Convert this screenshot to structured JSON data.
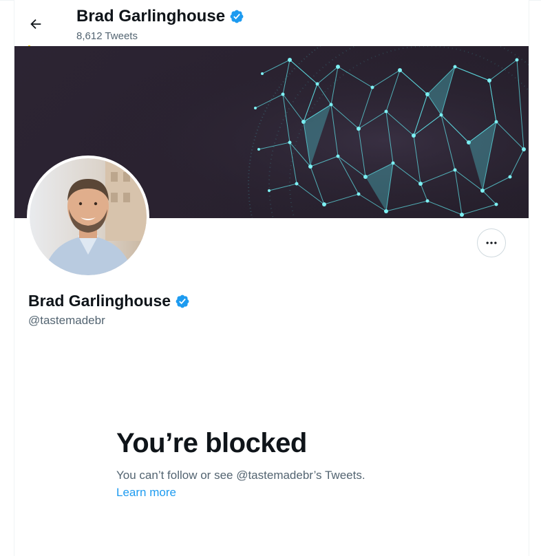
{
  "header": {
    "name": "Brad Garlinghouse",
    "tweet_count": "8,612 Tweets"
  },
  "profile": {
    "name": "Brad Garlinghouse",
    "handle": "@tastemadebr",
    "verified": true
  },
  "blocked": {
    "title": "You’re blocked",
    "message": "You can’t follow or see @tastemadebr’s Tweets.",
    "learn_more": "Learn more"
  },
  "icons": {
    "back": "arrow-left-icon",
    "verified": "verified-badge-icon",
    "more": "more-options-icon"
  },
  "colors": {
    "accent": "#1d9bf0",
    "text": "#0f1419",
    "secondary": "#536471",
    "banner_dark": "#2a2230",
    "network": "#4fd1d9"
  }
}
